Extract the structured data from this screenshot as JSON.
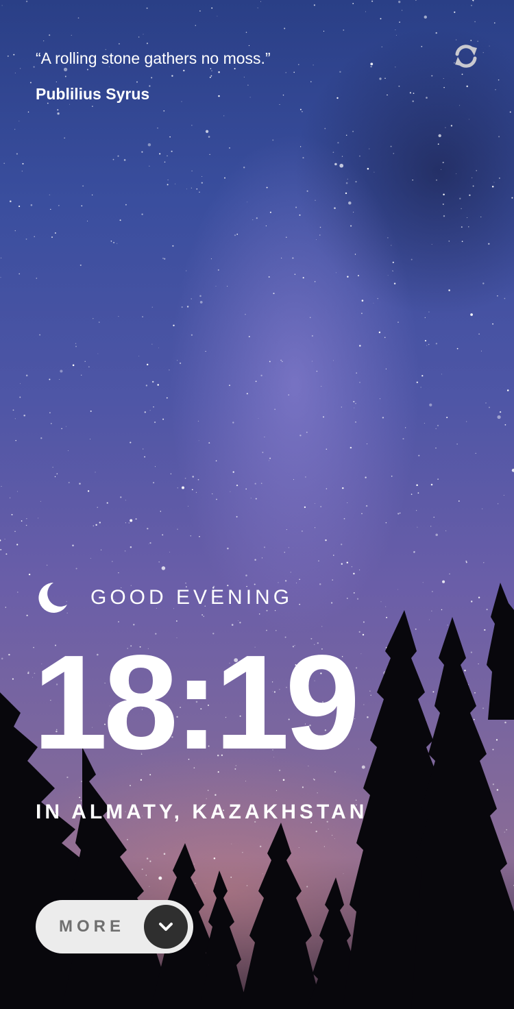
{
  "quote": {
    "text": "“A rolling stone gathers no moss.”",
    "author": "Publilius Syrus"
  },
  "icons": {
    "refresh": "refresh-icon",
    "moon": "moon-icon",
    "chevron": "chevron-down-icon"
  },
  "greeting": {
    "text": "GOOD EVENING"
  },
  "clock": {
    "time": "18:19"
  },
  "location": {
    "text": "IN ALMATY, KAZAKHSTAN"
  },
  "more_button": {
    "label": "MORE"
  },
  "colors": {
    "text": "#ffffff",
    "button_bg": "#ececec",
    "button_text": "#6f6f6f",
    "toggle_bg": "#2f2f2f"
  }
}
